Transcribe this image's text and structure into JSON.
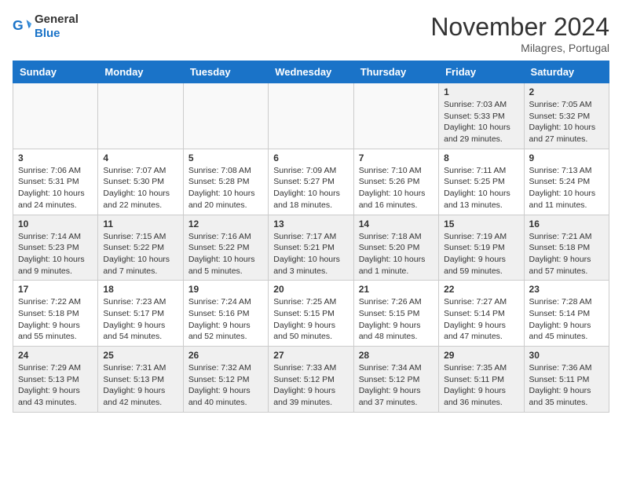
{
  "header": {
    "logo": {
      "general": "General",
      "blue": "Blue"
    },
    "title": "November 2024",
    "location": "Milagres, Portugal"
  },
  "calendar": {
    "weekdays": [
      "Sunday",
      "Monday",
      "Tuesday",
      "Wednesday",
      "Thursday",
      "Friday",
      "Saturday"
    ],
    "weeks": [
      [
        {
          "day": "",
          "info": ""
        },
        {
          "day": "",
          "info": ""
        },
        {
          "day": "",
          "info": ""
        },
        {
          "day": "",
          "info": ""
        },
        {
          "day": "",
          "info": ""
        },
        {
          "day": "1",
          "info": "Sunrise: 7:03 AM\nSunset: 5:33 PM\nDaylight: 10 hours\nand 29 minutes."
        },
        {
          "day": "2",
          "info": "Sunrise: 7:05 AM\nSunset: 5:32 PM\nDaylight: 10 hours\nand 27 minutes."
        }
      ],
      [
        {
          "day": "3",
          "info": "Sunrise: 7:06 AM\nSunset: 5:31 PM\nDaylight: 10 hours\nand 24 minutes."
        },
        {
          "day": "4",
          "info": "Sunrise: 7:07 AM\nSunset: 5:30 PM\nDaylight: 10 hours\nand 22 minutes."
        },
        {
          "day": "5",
          "info": "Sunrise: 7:08 AM\nSunset: 5:28 PM\nDaylight: 10 hours\nand 20 minutes."
        },
        {
          "day": "6",
          "info": "Sunrise: 7:09 AM\nSunset: 5:27 PM\nDaylight: 10 hours\nand 18 minutes."
        },
        {
          "day": "7",
          "info": "Sunrise: 7:10 AM\nSunset: 5:26 PM\nDaylight: 10 hours\nand 16 minutes."
        },
        {
          "day": "8",
          "info": "Sunrise: 7:11 AM\nSunset: 5:25 PM\nDaylight: 10 hours\nand 13 minutes."
        },
        {
          "day": "9",
          "info": "Sunrise: 7:13 AM\nSunset: 5:24 PM\nDaylight: 10 hours\nand 11 minutes."
        }
      ],
      [
        {
          "day": "10",
          "info": "Sunrise: 7:14 AM\nSunset: 5:23 PM\nDaylight: 10 hours\nand 9 minutes."
        },
        {
          "day": "11",
          "info": "Sunrise: 7:15 AM\nSunset: 5:22 PM\nDaylight: 10 hours\nand 7 minutes."
        },
        {
          "day": "12",
          "info": "Sunrise: 7:16 AM\nSunset: 5:22 PM\nDaylight: 10 hours\nand 5 minutes."
        },
        {
          "day": "13",
          "info": "Sunrise: 7:17 AM\nSunset: 5:21 PM\nDaylight: 10 hours\nand 3 minutes."
        },
        {
          "day": "14",
          "info": "Sunrise: 7:18 AM\nSunset: 5:20 PM\nDaylight: 10 hours\nand 1 minute."
        },
        {
          "day": "15",
          "info": "Sunrise: 7:19 AM\nSunset: 5:19 PM\nDaylight: 9 hours\nand 59 minutes."
        },
        {
          "day": "16",
          "info": "Sunrise: 7:21 AM\nSunset: 5:18 PM\nDaylight: 9 hours\nand 57 minutes."
        }
      ],
      [
        {
          "day": "17",
          "info": "Sunrise: 7:22 AM\nSunset: 5:18 PM\nDaylight: 9 hours\nand 55 minutes."
        },
        {
          "day": "18",
          "info": "Sunrise: 7:23 AM\nSunset: 5:17 PM\nDaylight: 9 hours\nand 54 minutes."
        },
        {
          "day": "19",
          "info": "Sunrise: 7:24 AM\nSunset: 5:16 PM\nDaylight: 9 hours\nand 52 minutes."
        },
        {
          "day": "20",
          "info": "Sunrise: 7:25 AM\nSunset: 5:15 PM\nDaylight: 9 hours\nand 50 minutes."
        },
        {
          "day": "21",
          "info": "Sunrise: 7:26 AM\nSunset: 5:15 PM\nDaylight: 9 hours\nand 48 minutes."
        },
        {
          "day": "22",
          "info": "Sunrise: 7:27 AM\nSunset: 5:14 PM\nDaylight: 9 hours\nand 47 minutes."
        },
        {
          "day": "23",
          "info": "Sunrise: 7:28 AM\nSunset: 5:14 PM\nDaylight: 9 hours\nand 45 minutes."
        }
      ],
      [
        {
          "day": "24",
          "info": "Sunrise: 7:29 AM\nSunset: 5:13 PM\nDaylight: 9 hours\nand 43 minutes."
        },
        {
          "day": "25",
          "info": "Sunrise: 7:31 AM\nSunset: 5:13 PM\nDaylight: 9 hours\nand 42 minutes."
        },
        {
          "day": "26",
          "info": "Sunrise: 7:32 AM\nSunset: 5:12 PM\nDaylight: 9 hours\nand 40 minutes."
        },
        {
          "day": "27",
          "info": "Sunrise: 7:33 AM\nSunset: 5:12 PM\nDaylight: 9 hours\nand 39 minutes."
        },
        {
          "day": "28",
          "info": "Sunrise: 7:34 AM\nSunset: 5:12 PM\nDaylight: 9 hours\nand 37 minutes."
        },
        {
          "day": "29",
          "info": "Sunrise: 7:35 AM\nSunset: 5:11 PM\nDaylight: 9 hours\nand 36 minutes."
        },
        {
          "day": "30",
          "info": "Sunrise: 7:36 AM\nSunset: 5:11 PM\nDaylight: 9 hours\nand 35 minutes."
        }
      ]
    ]
  }
}
